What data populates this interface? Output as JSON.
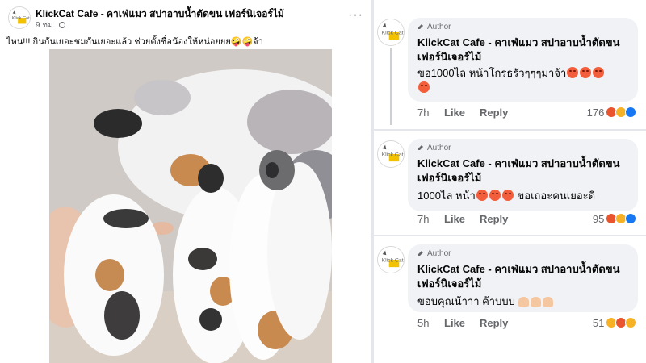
{
  "post": {
    "page_name": "KlickCat Cafe - คาเฟ่แมว สปาอาบน้ำตัดขน เฟอร์นิเจอร์ไม้",
    "time": "9 ชม.",
    "more_label": "···",
    "caption": "ไหน!!! กินกันเยอะชมกันเยอะแล้ว ช่วยตั้งชื่อน้องให้หน่อยยย🤪🤪จ้า",
    "photo_icon": "kittens-photo"
  },
  "logo": {
    "text": "Klick Cat"
  },
  "comments": [
    {
      "badge": "Author",
      "name": "KlickCat Cafe - คาเฟ่แมว สปาอาบน้ำตัดขน เฟอร์นิเจอร์ไม้",
      "text": "ขอ1000ไล หน้าโกรธรัวๆๆๆมาจ้า",
      "time": "7h",
      "like": "Like",
      "reply": "Reply",
      "count": "176"
    },
    {
      "badge": "Author",
      "name": "KlickCat Cafe - คาเฟ่แมว สปาอาบน้ำตัดขน เฟอร์นิเจอร์ไม้",
      "text_a": "1000ไล หน้า",
      "text_b": "ขอเถอะคนเยอะดี",
      "time": "7h",
      "like": "Like",
      "reply": "Reply",
      "count": "95"
    },
    {
      "badge": "Author",
      "name": "KlickCat Cafe - คาเฟ่แมว สปาอาบน้ำตัดขน เฟอร์นิเจอร์ไม้",
      "text": "ขอบคุณน้าาา ค้าบบบ",
      "time": "5h",
      "like": "Like",
      "reply": "Reply",
      "count": "51"
    }
  ],
  "colors": {
    "divider": "#e4e6eb",
    "bubble": "#f0f2f5",
    "angry": "#e9532d",
    "like": "#1877f2"
  }
}
